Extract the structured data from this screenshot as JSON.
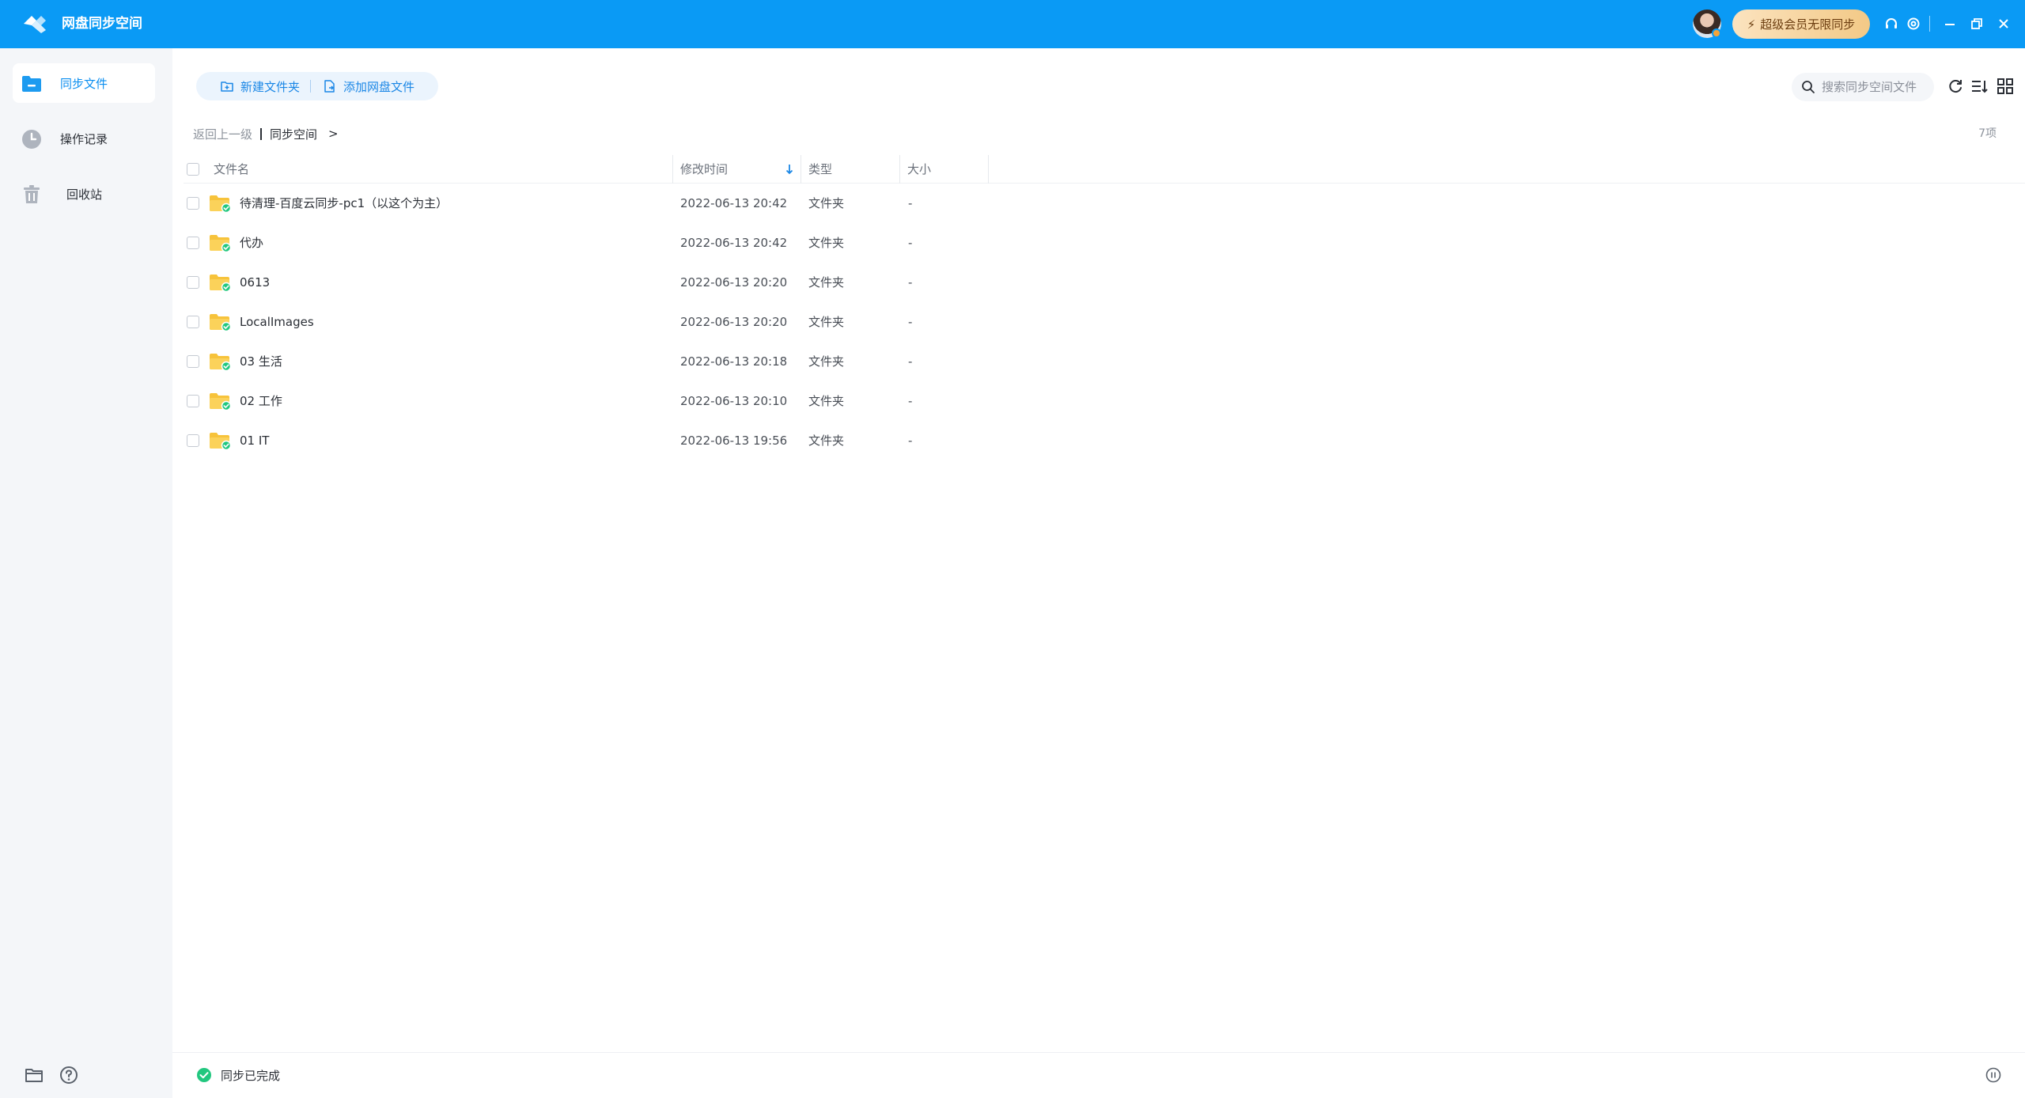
{
  "app": {
    "title": "网盘同步空间"
  },
  "header": {
    "vip_label": "超级会员无限同步"
  },
  "sidebar": {
    "items": [
      {
        "label": "同步文件",
        "icon": "folder-sync-icon",
        "active": true
      },
      {
        "label": "操作记录",
        "icon": "clock-icon",
        "active": false
      },
      {
        "label": "回收站",
        "icon": "trash-icon",
        "active": false
      }
    ]
  },
  "toolbar": {
    "new_folder_label": "新建文件夹",
    "add_netdisk_label": "添加网盘文件",
    "search_placeholder": "搜索同步空间文件"
  },
  "breadcrumb": {
    "back_label": "返回上一级",
    "current": "同步空间",
    "arrow": ">"
  },
  "item_count": "7项",
  "table": {
    "columns": {
      "name": "文件名",
      "modified": "修改时间",
      "type": "类型",
      "size": "大小"
    },
    "rows": [
      {
        "name": "待清理-百度云同步-pc1（以这个为主）",
        "modified": "2022-06-13 20:42",
        "type": "文件夹",
        "size": "-"
      },
      {
        "name": "代办",
        "modified": "2022-06-13 20:42",
        "type": "文件夹",
        "size": "-"
      },
      {
        "name": "0613",
        "modified": "2022-06-13 20:20",
        "type": "文件夹",
        "size": "-"
      },
      {
        "name": "LocalImages",
        "modified": "2022-06-13 20:20",
        "type": "文件夹",
        "size": "-"
      },
      {
        "name": "03 生活",
        "modified": "2022-06-13 20:18",
        "type": "文件夹",
        "size": "-"
      },
      {
        "name": "02 工作",
        "modified": "2022-06-13 20:10",
        "type": "文件夹",
        "size": "-"
      },
      {
        "name": "01 IT",
        "modified": "2022-06-13 19:56",
        "type": "文件夹",
        "size": "-"
      }
    ]
  },
  "status": {
    "text": "同步已完成"
  },
  "colors": {
    "brand": "#0a9af5",
    "accent": "#1b87e6",
    "folder": "#f7c33b",
    "sync_ok": "#22c77f"
  }
}
